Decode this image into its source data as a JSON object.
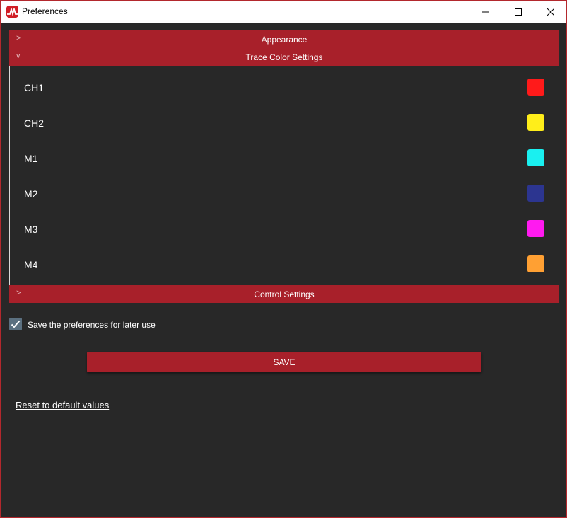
{
  "window": {
    "title": "Preferences",
    "icon": "app-logo-icon",
    "controls": [
      "minimize-icon",
      "maximize-icon",
      "close-icon"
    ]
  },
  "sections": {
    "appearance": {
      "label": "Appearance",
      "chevron": ">",
      "expanded": false
    },
    "trace": {
      "label": "Trace Color Settings",
      "chevron": "v",
      "expanded": true
    },
    "control": {
      "label": "Control Settings",
      "chevron": ">",
      "expanded": false
    }
  },
  "traces": [
    {
      "label": "CH1",
      "color": "#ff1a1a"
    },
    {
      "label": "CH2",
      "color": "#ffee1a"
    },
    {
      "label": "M1",
      "color": "#1af0f0"
    },
    {
      "label": "M2",
      "color": "#2c3590"
    },
    {
      "label": "M3",
      "color": "#ff1af0"
    },
    {
      "label": "M4",
      "color": "#ffa033"
    }
  ],
  "save_preferences": {
    "label": "Save the preferences for later use",
    "checked": true
  },
  "save_button": {
    "label": "SAVE"
  },
  "reset_link": {
    "label": "Reset to default values"
  },
  "colors": {
    "accent": "#a8202a",
    "background": "#282828",
    "checkbox": "#5b7080"
  }
}
